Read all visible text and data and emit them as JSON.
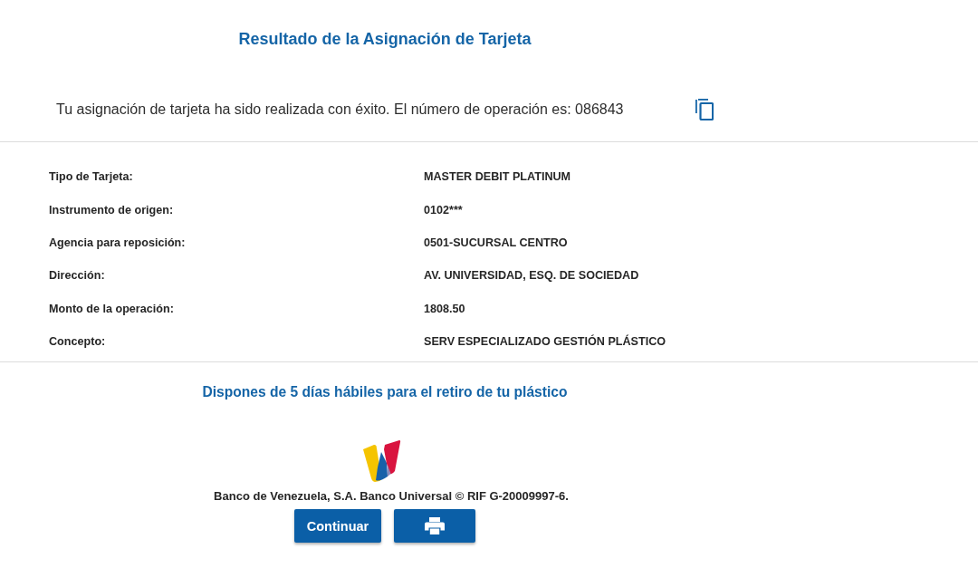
{
  "page": {
    "title": "Resultado de la Asignación de Tarjeta"
  },
  "confirmation": {
    "message": "Tu asignación de tarjeta ha sido realizada con éxito. El número de operación es: 086843"
  },
  "details": [
    {
      "label": "Tipo de Tarjeta:",
      "value": "MASTER DEBIT PLATINUM"
    },
    {
      "label": "Instrumento de origen:",
      "value": "0102***"
    },
    {
      "label": "Agencia para reposición:",
      "value": "0501-SUCURSAL CENTRO"
    },
    {
      "label": "Dirección:",
      "value": "AV. UNIVERSIDAD, ESQ. DE SOCIEDAD"
    },
    {
      "label": "Monto de la operación:",
      "value": "1808.50"
    },
    {
      "label": "Concepto:",
      "value": "SERV ESPECIALIZADO GESTIÓN PLÁSTICO"
    }
  ],
  "notice": "Dispones de 5 días hábiles para el retiro de tu plástico",
  "footer": {
    "copyright": "Banco de Venezuela, S.A. Banco Universal © RIF G-20009997-6."
  },
  "buttons": [
    {
      "kind": "text",
      "label": "Continuar"
    },
    {
      "kind": "print"
    }
  ]
}
